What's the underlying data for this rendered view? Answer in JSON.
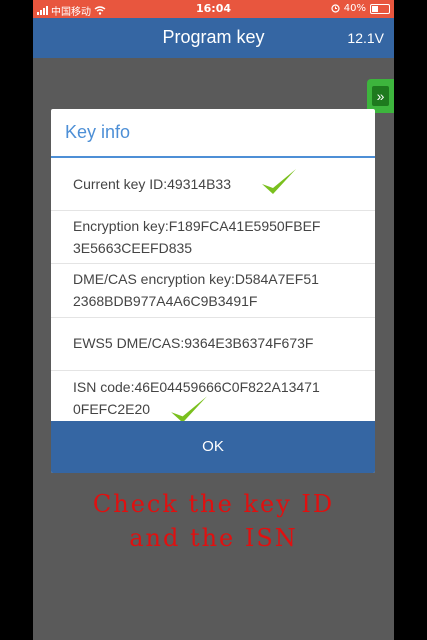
{
  "status_bar": {
    "carrier": "中国移动",
    "time": "16:04",
    "battery": "40%"
  },
  "header": {
    "title": "Program key",
    "voltage": "12.1V"
  },
  "dialog": {
    "title": "Key info",
    "rows": [
      {
        "line1": "Current key ID:49314B33",
        "line2": ""
      },
      {
        "line1": "Encryption key:F189FCA41E5950FBEF",
        "line2": "3E5663CEEFD835"
      },
      {
        "line1": "DME/CAS encryption key:D584A7EF51",
        "line2": "2368BDB977A4A6C9B3491F"
      },
      {
        "line1": "EWS5 DME/CAS:9364E3B6374F673F",
        "line2": ""
      },
      {
        "line1": "ISN code:46E04459666C0F822A13471",
        "line2": "0FEFC2E20"
      }
    ],
    "ok_label": "OK"
  },
  "annotation": {
    "line1": "Check the key ID",
    "line2": "and the ISN"
  },
  "colors": {
    "status_bar": "#e8563e",
    "header": "#3566a3",
    "accent": "#4d8fd6",
    "checkmark": "#7ac01e",
    "annotation": "#e01010"
  },
  "icons": [
    "wifi-icon",
    "signal-icon",
    "alarm-icon",
    "battery-icon",
    "double-chevron-right-icon",
    "checkmark-icon"
  ]
}
